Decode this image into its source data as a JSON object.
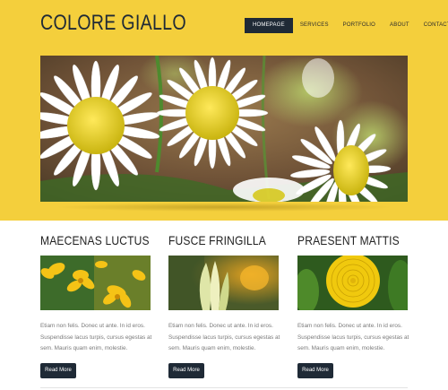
{
  "site": {
    "brand": "COLORE GIALLO"
  },
  "nav": [
    {
      "label": "HOMEPAGE",
      "active": true
    },
    {
      "label": "SERVICES"
    },
    {
      "label": "PORTFOLIO"
    },
    {
      "label": "ABOUT"
    },
    {
      "label": "CONTACT"
    }
  ],
  "hero": {
    "image": "white-daisies-photo"
  },
  "columns": [
    {
      "title": "MAECENAS LUCTUS",
      "image": "yellow-flowers-photo",
      "text": "Etiam non felis. Donec ut ante. In id eros. Suspendisse lacus turpis, cursus egestas at sem. Mauris quam enim, molestie.",
      "button": "Read More"
    },
    {
      "title": "FUSCE FRINGILLA",
      "image": "tulip-buds-photo",
      "text": "Etiam non felis. Donec ut ante. In id eros. Suspendisse lacus turpis, cursus egestas at sem. Mauris quam enim, molestie.",
      "button": "Read More"
    },
    {
      "title": "PRAESENT MATTIS",
      "image": "marigold-photo",
      "text": "Etiam non felis. Donec ut ante. In id eros. Suspendisse lacus turpis, cursus egestas at sem. Mauris quam enim, molestie.",
      "button": "Read More"
    }
  ],
  "colors": {
    "header_bg": "#f4cf3c",
    "dark": "#1f2a36",
    "body_text": "#7a7a7a"
  }
}
